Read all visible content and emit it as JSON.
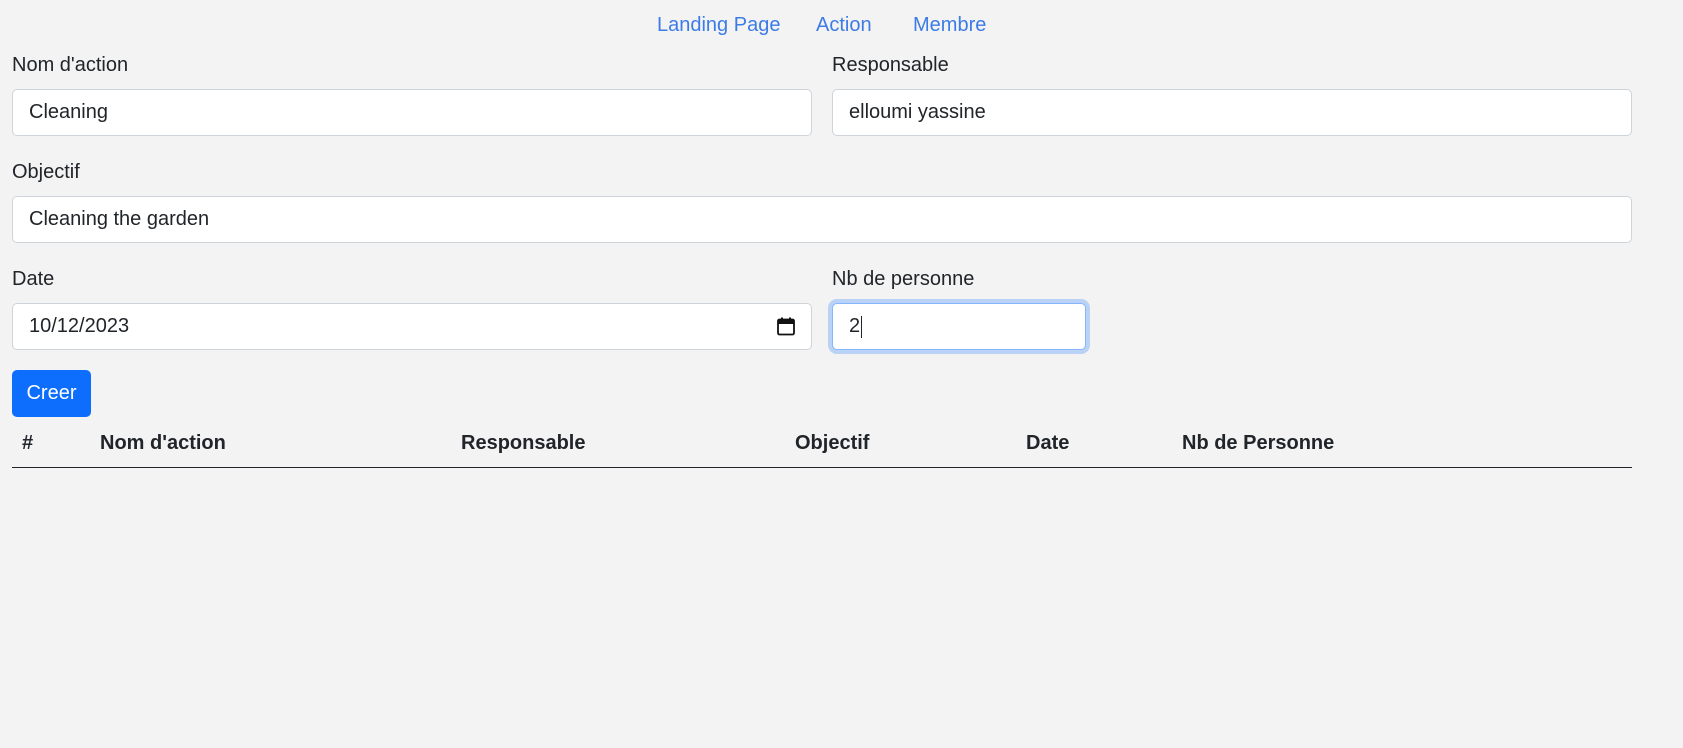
{
  "nav": {
    "links": [
      "Landing Page",
      "Action",
      "Membre"
    ]
  },
  "form": {
    "nom_action": {
      "label": "Nom d'action",
      "value": "Cleaning"
    },
    "responsable": {
      "label": "Responsable",
      "value": "elloumi yassine"
    },
    "objectif": {
      "label": "Objectif",
      "value": "Cleaning the garden"
    },
    "date": {
      "label": "Date",
      "value": "10/12/2023",
      "icon": "calendar-icon"
    },
    "nb_personne": {
      "label": "Nb de personne",
      "value": "2"
    },
    "submit_label": "Creer"
  },
  "table": {
    "columns": [
      "#",
      "Nom d'action",
      "Responsable",
      "Objectif",
      "Date",
      "Nb de Personne"
    ],
    "rows": []
  },
  "colors": {
    "link": "#3d7be6",
    "primary": "#0d6efd",
    "background": "#f3f3f3"
  }
}
